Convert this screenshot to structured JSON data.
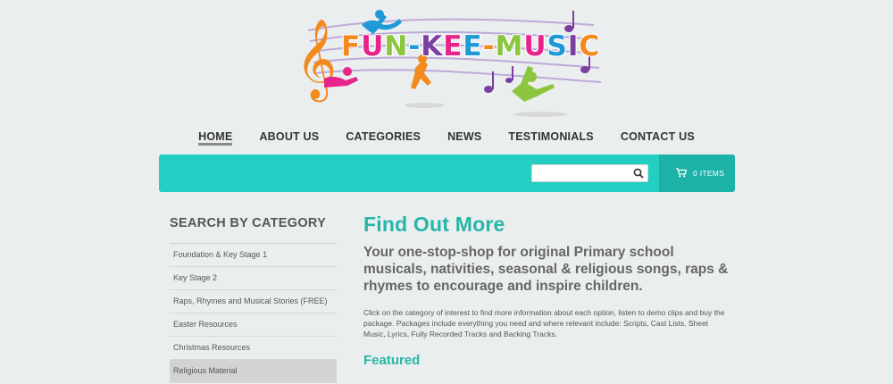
{
  "site": {
    "logo_text": "FUN-KEE-MUSIC",
    "logo_colors": [
      "#f28a1e",
      "#e8238a",
      "#8cc63f",
      "#1e9ad6",
      "#7b3fa0",
      "#e8238a",
      "#1e9ad6",
      "#f28a1e",
      "#8cc63f",
      "#e8238a",
      "#1e9ad6",
      "#7b3fa0",
      "#f28a1e"
    ]
  },
  "nav": {
    "items": [
      {
        "label": "HOME"
      },
      {
        "label": "ABOUT US"
      },
      {
        "label": "CATEGORIES"
      },
      {
        "label": "NEWS"
      },
      {
        "label": "TESTIMONIALS"
      },
      {
        "label": "CONTACT US"
      }
    ],
    "active": "HOME"
  },
  "search": {
    "value": "",
    "icon": "search-icon"
  },
  "cart": {
    "label": "0 ITEMS",
    "icon": "cart-icon"
  },
  "sidebar": {
    "title": "SEARCH BY CATEGORY",
    "items": [
      {
        "label": "Foundation & Key Stage 1"
      },
      {
        "label": "Key Stage 2"
      },
      {
        "label": "Raps, Rhymes and Musical Stories (FREE)"
      },
      {
        "label": "Easter Resources"
      },
      {
        "label": "Christmas Resources"
      },
      {
        "label": "Religious Material"
      }
    ],
    "selected": "Religious Material"
  },
  "main": {
    "title": "Find Out More",
    "intro": "Your one-stop-shop for original Primary school musicals, nativities, seasonal & religious songs, raps & rhymes to encourage and inspire children.",
    "body": "Click on the category of interest to find more information about each option, listen to demo clips and buy the package. Packages include everything you need and where relevant include: Scripts, Cast Lists, Sheet Music, Lyrics, Fully Recorded Tracks and Backing Tracks.",
    "featured_heading": "Featured"
  },
  "colors": {
    "background": "#ebeeef",
    "accent_teal": "#23cfc2",
    "accent_teal_dark": "#1cb2a8",
    "heading_teal": "#26b6a8"
  }
}
